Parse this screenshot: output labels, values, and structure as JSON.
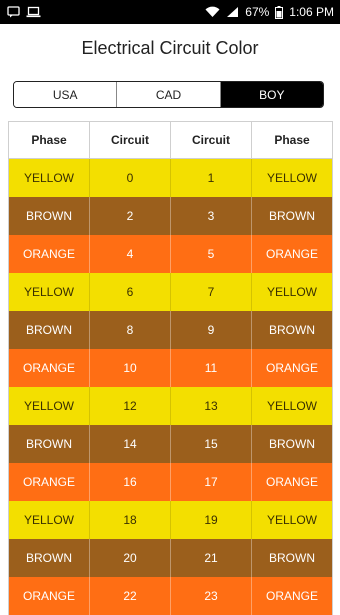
{
  "status_bar": {
    "battery": "67%",
    "time": "1:06 PM",
    "left_icons": [
      "message-icon",
      "laptop-icon"
    ],
    "right_icons": [
      "wifi-icon",
      "signal-icon",
      "battery-icon"
    ]
  },
  "title": "Electrical Circuit Color",
  "tabs": [
    {
      "label": "USA",
      "active": false
    },
    {
      "label": "CAD",
      "active": false
    },
    {
      "label": "BOY",
      "active": true
    }
  ],
  "table": {
    "headers": [
      "Phase",
      "Circuit",
      "Circuit",
      "Phase"
    ],
    "rows": [
      {
        "color": "yellow",
        "left_phase": "YELLOW",
        "left_circuit": "0",
        "right_circuit": "1",
        "right_phase": "YELLOW"
      },
      {
        "color": "brown",
        "left_phase": "BROWN",
        "left_circuit": "2",
        "right_circuit": "3",
        "right_phase": "BROWN"
      },
      {
        "color": "orange",
        "left_phase": "ORANGE",
        "left_circuit": "4",
        "right_circuit": "5",
        "right_phase": "ORANGE"
      },
      {
        "color": "yellow",
        "left_phase": "YELLOW",
        "left_circuit": "6",
        "right_circuit": "7",
        "right_phase": "YELLOW"
      },
      {
        "color": "brown",
        "left_phase": "BROWN",
        "left_circuit": "8",
        "right_circuit": "9",
        "right_phase": "BROWN"
      },
      {
        "color": "orange",
        "left_phase": "ORANGE",
        "left_circuit": "10",
        "right_circuit": "11",
        "right_phase": "ORANGE"
      },
      {
        "color": "yellow",
        "left_phase": "YELLOW",
        "left_circuit": "12",
        "right_circuit": "13",
        "right_phase": "YELLOW"
      },
      {
        "color": "brown",
        "left_phase": "BROWN",
        "left_circuit": "14",
        "right_circuit": "15",
        "right_phase": "BROWN"
      },
      {
        "color": "orange",
        "left_phase": "ORANGE",
        "left_circuit": "16",
        "right_circuit": "17",
        "right_phase": "ORANGE"
      },
      {
        "color": "yellow",
        "left_phase": "YELLOW",
        "left_circuit": "18",
        "right_circuit": "19",
        "right_phase": "YELLOW"
      },
      {
        "color": "brown",
        "left_phase": "BROWN",
        "left_circuit": "20",
        "right_circuit": "21",
        "right_phase": "BROWN"
      },
      {
        "color": "orange",
        "left_phase": "ORANGE",
        "left_circuit": "22",
        "right_circuit": "23",
        "right_phase": "ORANGE"
      }
    ]
  },
  "colors": {
    "yellow": "#f3df00",
    "brown": "#9b5f1c",
    "orange": "#ff6e14",
    "active_tab": "#000000"
  }
}
